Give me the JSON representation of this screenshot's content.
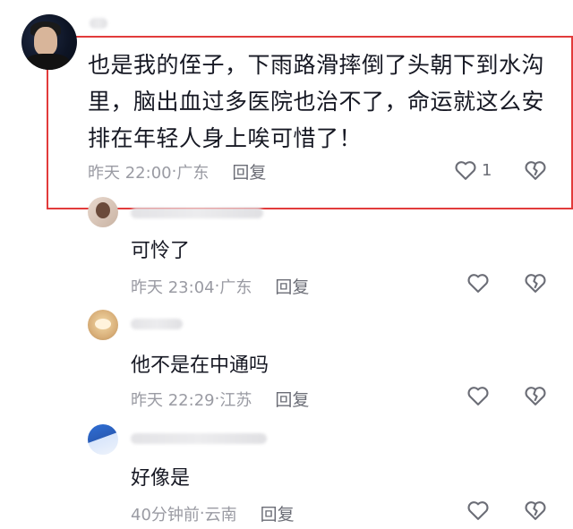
{
  "main_comment": {
    "text": "也是我的侄子，下雨路滑摔倒了头朝下到水沟里，脑出血过多医院也治不了，命运就这么安排在年轻人身上唉可惜了！",
    "time": "昨天 22:00",
    "location": "广东",
    "reply_label": "回复",
    "like_count": "1"
  },
  "replies": [
    {
      "text": "可怜了",
      "time": "昨天 23:04",
      "location": "广东",
      "reply_label": "回复"
    },
    {
      "text": "他不是在中通吗",
      "time": "昨天 22:29",
      "location": "江苏",
      "reply_label": "回复"
    },
    {
      "text": "好像是",
      "time": "40分钟前",
      "location": "云南",
      "reply_label": "回复"
    }
  ],
  "separator": "·",
  "icons": {
    "like": "heart-outline-icon",
    "dislike": "broken-heart-icon"
  },
  "colors": {
    "highlight_border": "#e23b3b",
    "meta_text": "#9a9ba3",
    "body_text": "#161823"
  }
}
